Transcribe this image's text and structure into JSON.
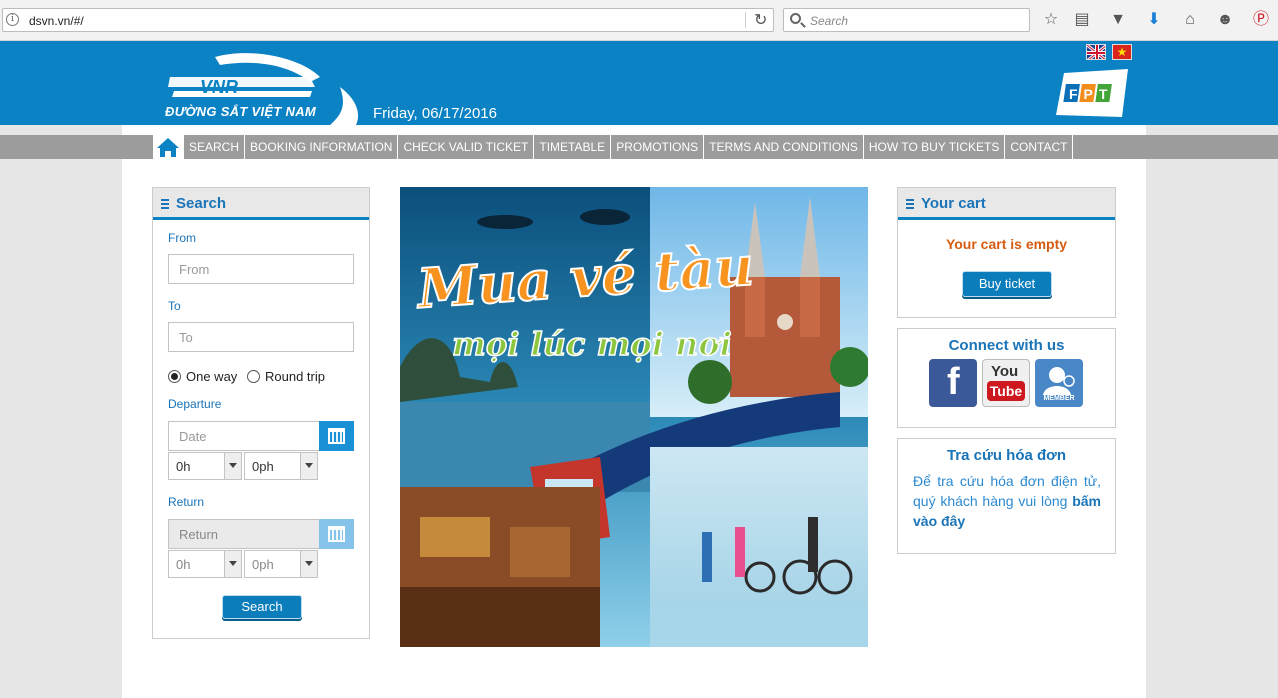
{
  "browser": {
    "url": "dsvn.vn/#/",
    "search_placeholder": "Search",
    "info_glyph": "i"
  },
  "header": {
    "logo_mark": "VNR",
    "logo_text": "ĐƯỜNG SẮT VIỆT NAM",
    "date": "Friday, 06/17/2016",
    "sponsor": "FPT"
  },
  "nav": {
    "items": [
      "SEARCH",
      "BOOKING INFORMATION",
      "CHECK VALID TICKET",
      "TIMETABLE",
      "PROMOTIONS",
      "TERMS AND CONDITIONS",
      "HOW TO BUY TICKETS",
      "CONTACT"
    ]
  },
  "search": {
    "title": "Search",
    "from_label": "From",
    "from_placeholder": "From",
    "to_label": "To",
    "to_placeholder": "To",
    "one_way": "One way",
    "round_trip": "Round trip",
    "departure_label": "Departure",
    "date_placeholder": "Date",
    "hour_value": "0h",
    "minute_value": "0ph",
    "return_label": "Return",
    "return_placeholder": "Return",
    "return_hour": "0h",
    "return_minute": "0ph",
    "button": "Search"
  },
  "banner": {
    "headline": "Mua vé tàu",
    "subline": "mọi lúc mọi nơi"
  },
  "cart": {
    "title": "Your cart",
    "empty_text": "Your cart is empty",
    "button": "Buy ticket"
  },
  "connect": {
    "title": "Connect with us",
    "facebook": "f",
    "youtube_top": "You",
    "youtube_bottom": "Tube",
    "member": "MEMBER"
  },
  "invoice": {
    "title": "Tra cứu hóa đơn",
    "text": "Để tra cứu hóa đơn điện tử, quý khách hàng vui lòng ",
    "link": "bấm vào đây"
  },
  "colors": {
    "brand_blue": "#0b82c4",
    "nav_gray": "#9c9c9c",
    "cart_empty": "#d65c12"
  }
}
